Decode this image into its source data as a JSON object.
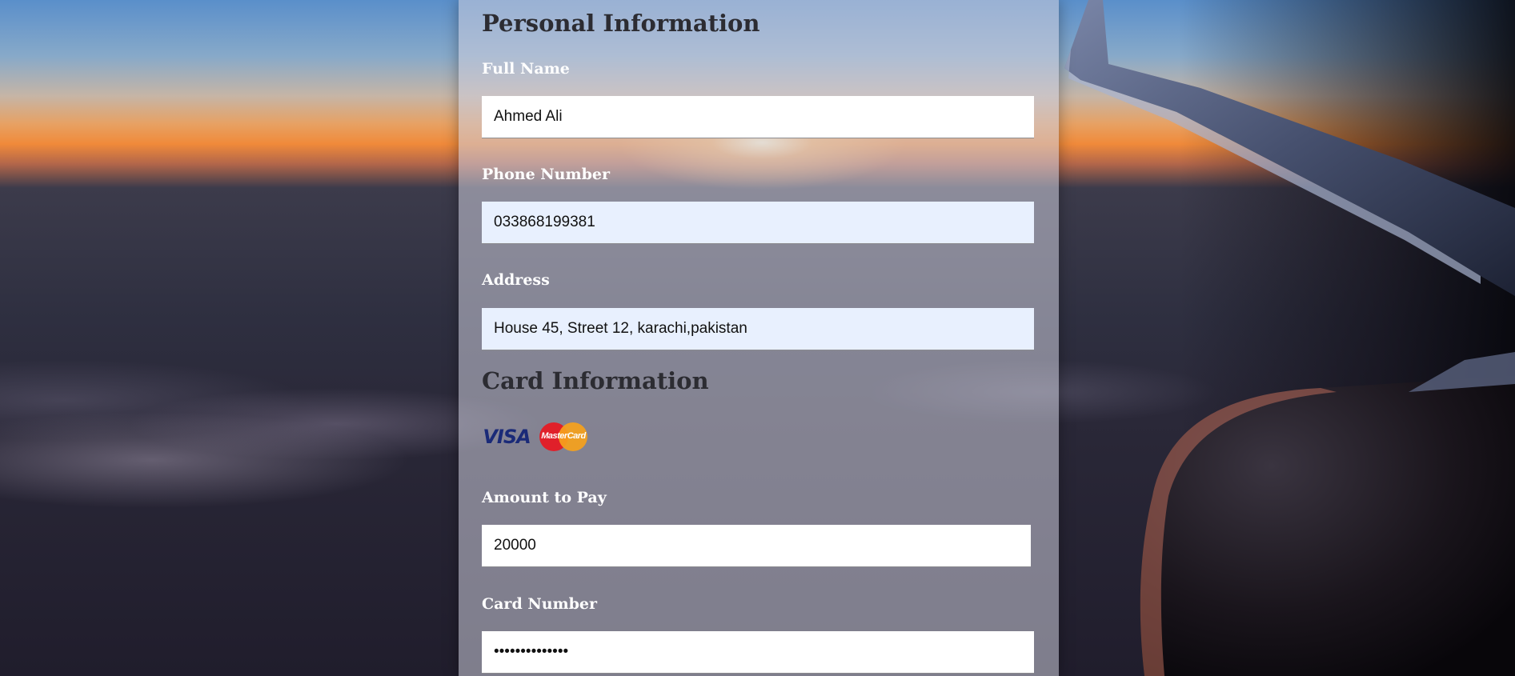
{
  "personal": {
    "heading": "Personal Information",
    "full_name_label": "Full Name",
    "full_name_value": "Ahmed Ali",
    "phone_label": "Phone Number",
    "phone_value": "033868199381",
    "address_label": "Address",
    "address_value": "House 45, Street 12, karachi,pakistan"
  },
  "card": {
    "heading": "Card Information",
    "logos": {
      "visa_text": "VISA",
      "mastercard_text": "MasterCard"
    },
    "amount_label": "Amount to Pay",
    "amount_value": "20000",
    "card_number_label": "Card Number",
    "card_number_value": "••••••••••••••"
  },
  "colors": {
    "panel_overlay": "#cdcddc",
    "heading_text": "#2c2c32",
    "label_text": "#ffffff",
    "autofill_bg": "#e8f0fe",
    "visa_blue": "#1a2a78",
    "mc_red": "#e0202a",
    "mc_orange": "#f6a21c"
  },
  "icons": [
    "visa-logo",
    "mastercard-logo"
  ]
}
